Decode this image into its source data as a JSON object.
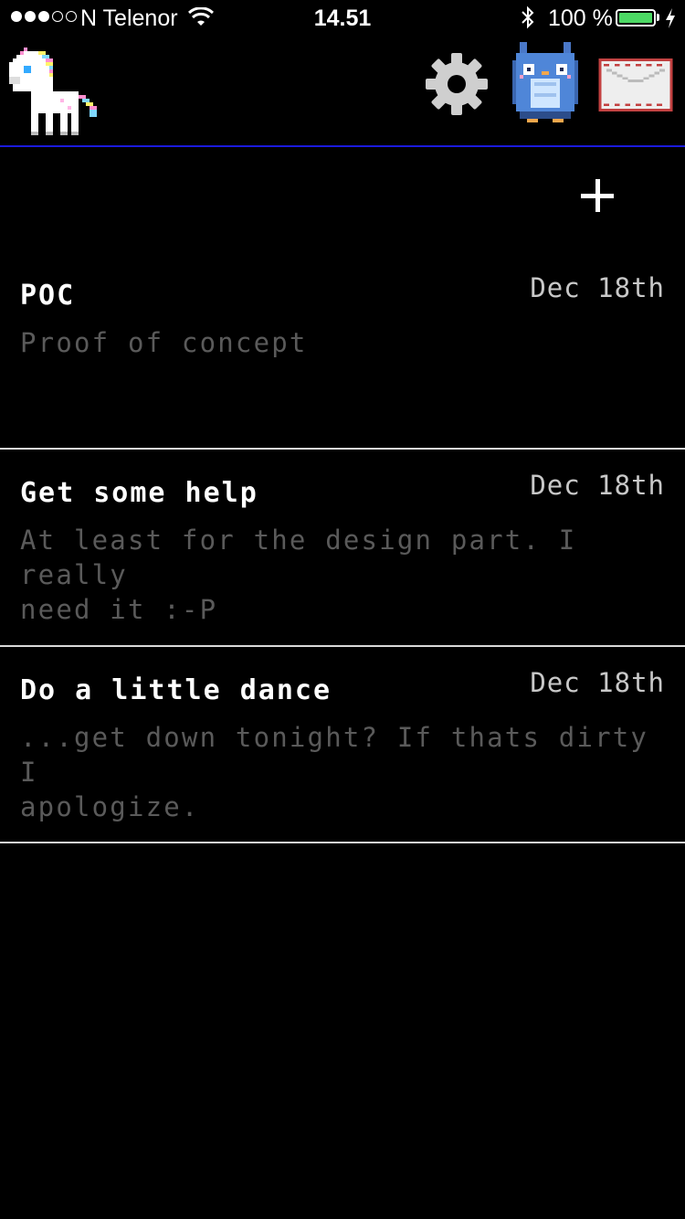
{
  "status_bar": {
    "signal_dots_filled": 3,
    "signal_dots_total": 5,
    "carrier": "N Telenor",
    "time": "14.51",
    "battery_percent": "100 %",
    "battery_color": "#4cd964"
  },
  "header": {
    "accent_color": "#1a1adc",
    "icons": [
      "unicorn-logo-icon",
      "gear-icon",
      "owl-avatar-icon",
      "mail-icon"
    ]
  },
  "list": {
    "add_icon": "plus-icon",
    "items": [
      {
        "title": "POC",
        "date": "Dec 18th",
        "body": "Proof of concept"
      },
      {
        "title": "Get some help",
        "date": "Dec 18th",
        "body": "At least for the design part. I really\nneed it :-P"
      },
      {
        "title": "Do a little dance",
        "date": "Dec 18th",
        "body": "...get down tonight? If thats dirty I\napologize."
      }
    ]
  }
}
